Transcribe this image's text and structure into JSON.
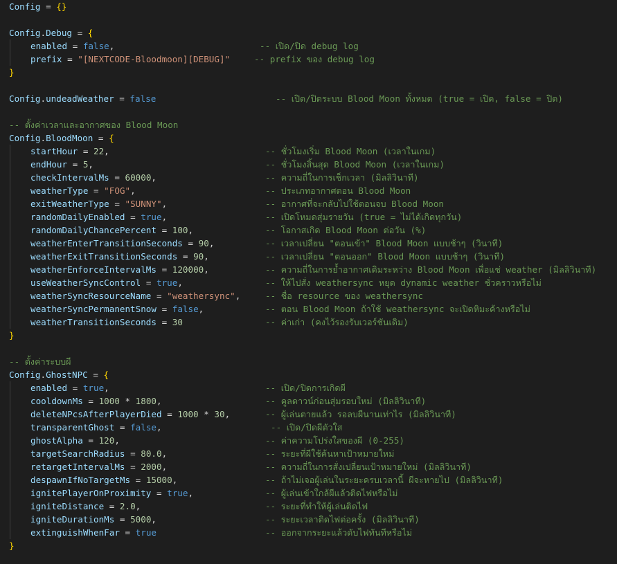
{
  "theme": {
    "background": "#1e1e1e",
    "default": "#d4d4d4",
    "variable": "#9cdcfe",
    "keyword": "#569cd6",
    "number": "#b5cea8",
    "string": "#ce9178",
    "comment": "#6a9955",
    "brace": "#ffd700"
  },
  "lines": [
    {
      "code": [
        [
          "var",
          "Config"
        ],
        [
          "punc",
          " = "
        ],
        [
          "brace",
          "{}"
        ]
      ]
    },
    {
      "code": []
    },
    {
      "code": [
        [
          "var",
          "Config"
        ],
        [
          "punc",
          "."
        ],
        [
          "var",
          "Debug"
        ],
        [
          "punc",
          " = "
        ],
        [
          "brace",
          "{"
        ]
      ]
    },
    {
      "indent": true,
      "code": [
        [
          "var",
          "enabled"
        ],
        [
          "punc",
          " = "
        ],
        [
          "kw",
          "false"
        ],
        [
          "punc",
          ","
        ]
      ],
      "comment": "-- เปิด/ปิด debug log",
      "ccol": 362
    },
    {
      "indent": true,
      "code": [
        [
          "var",
          "prefix"
        ],
        [
          "punc",
          " = "
        ],
        [
          "str",
          "\"[NEXTCODE-Bloodmoon][DEBUG]\""
        ]
      ],
      "comment": "-- prefix ของ debug log",
      "ccol": 354
    },
    {
      "code": [
        [
          "brace",
          "}"
        ]
      ]
    },
    {
      "code": []
    },
    {
      "code": [
        [
          "var",
          "Config"
        ],
        [
          "punc",
          "."
        ],
        [
          "var",
          "undeadWeather"
        ],
        [
          "punc",
          " = "
        ],
        [
          "kw",
          "false"
        ]
      ],
      "comment": "-- เปิด/ปิดระบบ Blood Moon ทั้งหมด (true = เปิด, false = ปิด)",
      "ccol": 385
    },
    {
      "code": []
    },
    {
      "code": [],
      "comment": "-- ตั้งค่าเวลาและอากาศของ Blood Moon",
      "ccol": 0
    },
    {
      "code": [
        [
          "var",
          "Config"
        ],
        [
          "punc",
          "."
        ],
        [
          "var",
          "BloodMoon"
        ],
        [
          "punc",
          " = "
        ],
        [
          "brace",
          "{"
        ]
      ]
    },
    {
      "indent": true,
      "code": [
        [
          "var",
          "startHour"
        ],
        [
          "punc",
          " = "
        ],
        [
          "num",
          "22"
        ],
        [
          "punc",
          ","
        ]
      ],
      "comment": "-- ชั่วโมงเริ่ม Blood Moon (เวลาในเกม)",
      "ccol": 370
    },
    {
      "indent": true,
      "code": [
        [
          "var",
          "endHour"
        ],
        [
          "punc",
          " = "
        ],
        [
          "num",
          "5"
        ],
        [
          "punc",
          ","
        ]
      ],
      "comment": "-- ชั่วโมงสิ้นสุด Blood Moon (เวลาในเกม)",
      "ccol": 370
    },
    {
      "indent": true,
      "code": [
        [
          "var",
          "checkIntervalMs"
        ],
        [
          "punc",
          " = "
        ],
        [
          "num",
          "60000"
        ],
        [
          "punc",
          ","
        ]
      ],
      "comment": "-- ความถี่ในการเช็กเวลา (มิลลิวินาที)",
      "ccol": 370
    },
    {
      "indent": true,
      "code": [
        [
          "var",
          "weatherType"
        ],
        [
          "punc",
          " = "
        ],
        [
          "str",
          "\"FOG\""
        ],
        [
          "punc",
          ","
        ]
      ],
      "comment": "-- ประเภทอากาศตอน Blood Moon",
      "ccol": 370
    },
    {
      "indent": true,
      "code": [
        [
          "var",
          "exitWeatherType"
        ],
        [
          "punc",
          " = "
        ],
        [
          "str",
          "\"SUNNY\""
        ],
        [
          "punc",
          ","
        ]
      ],
      "comment": "-- อากาศที่จะกลับไปใช้ตอนจบ Blood Moon",
      "ccol": 370
    },
    {
      "indent": true,
      "code": [
        [
          "var",
          "randomDailyEnabled"
        ],
        [
          "punc",
          " = "
        ],
        [
          "kw",
          "true"
        ],
        [
          "punc",
          ","
        ]
      ],
      "comment": "-- เปิดโหมดสุ่มรายวัน (true = ไม่ได้เกิดทุกวัน)",
      "ccol": 370
    },
    {
      "indent": true,
      "code": [
        [
          "var",
          "randomDailyChancePercent"
        ],
        [
          "punc",
          " = "
        ],
        [
          "num",
          "100"
        ],
        [
          "punc",
          ","
        ]
      ],
      "comment": "-- โอกาสเกิด Blood Moon ต่อวัน (%)",
      "ccol": 370
    },
    {
      "indent": true,
      "code": [
        [
          "var",
          "weatherEnterTransitionSeconds"
        ],
        [
          "punc",
          " = "
        ],
        [
          "num",
          "90"
        ],
        [
          "punc",
          ","
        ]
      ],
      "comment": "-- เวลาเปลี่ยน \"ตอนเข้า\" Blood Moon แบบช้าๆ (วินาที)",
      "ccol": 370
    },
    {
      "indent": true,
      "code": [
        [
          "var",
          "weatherExitTransitionSeconds"
        ],
        [
          "punc",
          " = "
        ],
        [
          "num",
          "90"
        ],
        [
          "punc",
          ","
        ]
      ],
      "comment": "-- เวลาเปลี่ยน \"ตอนออก\" Blood Moon แบบช้าๆ (วินาที)",
      "ccol": 370
    },
    {
      "indent": true,
      "code": [
        [
          "var",
          "weatherEnforceIntervalMs"
        ],
        [
          "punc",
          " = "
        ],
        [
          "num",
          "120000"
        ],
        [
          "punc",
          ","
        ]
      ],
      "comment": "-- ความถี่ในการย้ำอากาศเดิมระหว่าง Blood Moon เพื่อแช่ weather (มิลลิวินาที)",
      "ccol": 370
    },
    {
      "indent": true,
      "code": [
        [
          "var",
          "useWeatherSyncControl"
        ],
        [
          "punc",
          " = "
        ],
        [
          "kw",
          "true"
        ],
        [
          "punc",
          ","
        ]
      ],
      "comment": "-- ให้ไปสั่ง weathersync หยุด dynamic weather ชั่วคราวหรือไม่",
      "ccol": 370
    },
    {
      "indent": true,
      "code": [
        [
          "var",
          "weatherSyncResourceName"
        ],
        [
          "punc",
          " = "
        ],
        [
          "str",
          "\"weathersync\""
        ],
        [
          "punc",
          ","
        ]
      ],
      "comment": "-- ชื่อ resource ของ weathersync",
      "ccol": 370
    },
    {
      "indent": true,
      "code": [
        [
          "var",
          "weatherSyncPermanentSnow"
        ],
        [
          "punc",
          " = "
        ],
        [
          "kw",
          "false"
        ],
        [
          "punc",
          ","
        ]
      ],
      "comment": "-- ตอน Blood Moon ถ้าใช้ weathersync จะเปิดหิมะค้างหรือไม่",
      "ccol": 370
    },
    {
      "indent": true,
      "code": [
        [
          "var",
          "weatherTransitionSeconds"
        ],
        [
          "punc",
          " = "
        ],
        [
          "num",
          "30"
        ]
      ],
      "comment": "-- ค่าเก่า (คงไว้รองรับเวอร์ชันเดิม)",
      "ccol": 370
    },
    {
      "code": [
        [
          "brace",
          "}"
        ]
      ]
    },
    {
      "code": []
    },
    {
      "code": [],
      "comment": "-- ตั้งค่าระบบผี",
      "ccol": 0
    },
    {
      "code": [
        [
          "var",
          "Config"
        ],
        [
          "punc",
          "."
        ],
        [
          "var",
          "GhostNPC"
        ],
        [
          "punc",
          " = "
        ],
        [
          "brace",
          "{"
        ]
      ]
    },
    {
      "indent": true,
      "code": [
        [
          "var",
          "enabled"
        ],
        [
          "punc",
          " = "
        ],
        [
          "kw",
          "true"
        ],
        [
          "punc",
          ","
        ]
      ],
      "comment": "-- เปิด/ปิดการเกิดผี",
      "ccol": 370
    },
    {
      "indent": true,
      "code": [
        [
          "var",
          "cooldownMs"
        ],
        [
          "punc",
          " = "
        ],
        [
          "num",
          "1000"
        ],
        [
          "punc",
          " * "
        ],
        [
          "num",
          "1800"
        ],
        [
          "punc",
          ","
        ]
      ],
      "comment": "-- คูลดาวน์ก่อนสุ่มรอบใหม่ (มิลลิวินาที)",
      "ccol": 370
    },
    {
      "indent": true,
      "code": [
        [
          "var",
          "deleteNPcsAfterPlayerDied"
        ],
        [
          "punc",
          " = "
        ],
        [
          "num",
          "1000"
        ],
        [
          "punc",
          " * "
        ],
        [
          "num",
          "30"
        ],
        [
          "punc",
          ","
        ]
      ],
      "comment": "-- ผู้เล่นตายแล้ว รอลบผีนานเท่าไร (มิลลิวินาที)",
      "ccol": 370
    },
    {
      "indent": true,
      "code": [
        [
          "var",
          "transparentGhost"
        ],
        [
          "punc",
          " = "
        ],
        [
          "kw",
          "false"
        ],
        [
          "punc",
          ","
        ]
      ],
      "comment": "-- เปิด/ปิดผีตัวใส",
      "ccol": 378
    },
    {
      "indent": true,
      "code": [
        [
          "var",
          "ghostAlpha"
        ],
        [
          "punc",
          " = "
        ],
        [
          "num",
          "120"
        ],
        [
          "punc",
          ","
        ]
      ],
      "comment": "-- ค่าความโปร่งใสของผี (0-255)",
      "ccol": 370
    },
    {
      "indent": true,
      "code": [
        [
          "var",
          "targetSearchRadius"
        ],
        [
          "punc",
          " = "
        ],
        [
          "num",
          "80.0"
        ],
        [
          "punc",
          ","
        ]
      ],
      "comment": "-- ระยะที่ผีใช้ค้นหาเป้าหมายใหม่",
      "ccol": 370
    },
    {
      "indent": true,
      "code": [
        [
          "var",
          "retargetIntervalMs"
        ],
        [
          "punc",
          " = "
        ],
        [
          "num",
          "2000"
        ],
        [
          "punc",
          ","
        ]
      ],
      "comment": "-- ความถี่ในการสั่งเปลี่ยนเป้าหมายใหม่ (มิลลิวินาที)",
      "ccol": 370
    },
    {
      "indent": true,
      "code": [
        [
          "var",
          "despawnIfNoTargetMs"
        ],
        [
          "punc",
          " = "
        ],
        [
          "num",
          "15000"
        ],
        [
          "punc",
          ","
        ]
      ],
      "comment": "-- ถ้าไม่เจอผู้เล่นในระยะครบเวลานี้ ผีจะหายไป (มิลลิวินาที)",
      "ccol": 370
    },
    {
      "indent": true,
      "code": [
        [
          "var",
          "ignitePlayerOnProximity"
        ],
        [
          "punc",
          " = "
        ],
        [
          "kw",
          "true"
        ],
        [
          "punc",
          ","
        ]
      ],
      "comment": "-- ผู้เล่นเข้าใกล้ผีแล้วติดไฟหรือไม่",
      "ccol": 370
    },
    {
      "indent": true,
      "code": [
        [
          "var",
          "igniteDistance"
        ],
        [
          "punc",
          " = "
        ],
        [
          "num",
          "2.0"
        ],
        [
          "punc",
          ","
        ]
      ],
      "comment": "-- ระยะที่ทำให้ผู้เล่นติดไฟ",
      "ccol": 370
    },
    {
      "indent": true,
      "code": [
        [
          "var",
          "igniteDurationMs"
        ],
        [
          "punc",
          " = "
        ],
        [
          "num",
          "5000"
        ],
        [
          "punc",
          ","
        ]
      ],
      "comment": "-- ระยะเวลาติดไฟต่อครั้ง (มิลลิวินาที)",
      "ccol": 370
    },
    {
      "indent": true,
      "code": [
        [
          "var",
          "extinguishWhenFar"
        ],
        [
          "punc",
          " = "
        ],
        [
          "kw",
          "true"
        ]
      ],
      "comment": "-- ออกจากระยะแล้วดับไฟทันทีหรือไม่",
      "ccol": 370
    },
    {
      "code": [
        [
          "brace",
          "}"
        ]
      ]
    }
  ]
}
